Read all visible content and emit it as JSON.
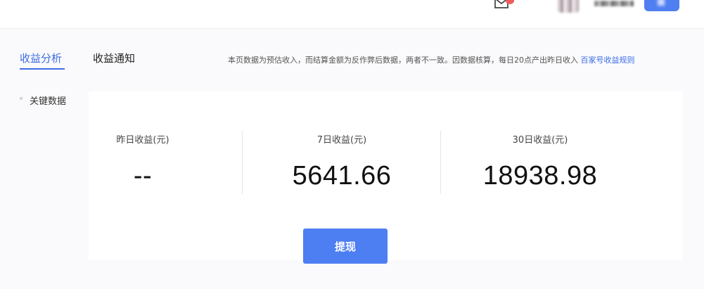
{
  "header": {
    "mail_icon": "mail-icon",
    "mail_badge_color": "#f15a5a",
    "user_button_color": "#4f7ff0"
  },
  "tabs": [
    {
      "label": "收益分析",
      "active": true
    },
    {
      "label": "收益通知",
      "active": false
    }
  ],
  "notice": {
    "text": "本页数据为预估收入，而结算金额为反作弊后数据，两者不一致。因数据核算，每日20点产出昨日收入",
    "link_text": "百家号收益规则"
  },
  "section": {
    "title": "关键数据"
  },
  "metrics": [
    {
      "label": "昨日收益(元)",
      "value": "--"
    },
    {
      "label": "7日收益(元)",
      "value": "5641.66"
    },
    {
      "label": "30日收益(元)",
      "value": "18938.98"
    }
  ],
  "actions": {
    "withdraw_label": "提现"
  },
  "colors": {
    "accent": "#3c6de4",
    "button": "#4d7ef2"
  }
}
